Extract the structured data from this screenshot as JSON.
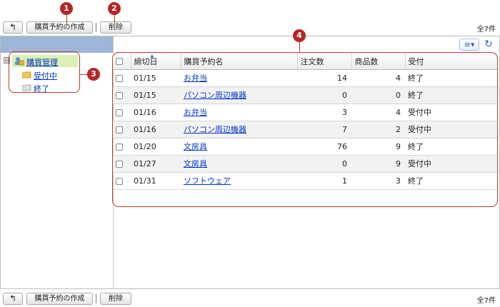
{
  "toolbar": {
    "back_icon": "undo-arrow-icon",
    "back_glyph": "↰",
    "create_label": "購買予約の作成",
    "delete_label": "削除",
    "count_label": "全7件"
  },
  "tree": {
    "root_label": "購買管理",
    "expander": "⊟",
    "items": [
      {
        "label": "受付中"
      },
      {
        "label": "終了"
      }
    ]
  },
  "view_toggle": "≡▾",
  "refresh_glyph": "↻",
  "table": {
    "headers": [
      "締切日",
      "購買予約名",
      "注文数",
      "商品数",
      "受付"
    ],
    "rows": [
      {
        "date": "01/15",
        "name": "お弁当",
        "orders": "14",
        "items": "4",
        "status": "終了"
      },
      {
        "date": "01/15",
        "name": "パソコン周辺機器",
        "orders": "0",
        "items": "0",
        "status": "終了"
      },
      {
        "date": "01/16",
        "name": "お弁当",
        "orders": "3",
        "items": "4",
        "status": "受付中"
      },
      {
        "date": "01/16",
        "name": "パソコン周辺機器",
        "orders": "7",
        "items": "2",
        "status": "受付中"
      },
      {
        "date": "01/20",
        "name": "文房具",
        "orders": "76",
        "items": "9",
        "status": "終了"
      },
      {
        "date": "01/27",
        "name": "文房具",
        "orders": "0",
        "items": "9",
        "status": "受付中"
      },
      {
        "date": "01/31",
        "name": "ソフトウェア",
        "orders": "1",
        "items": "3",
        "status": "終了"
      }
    ]
  },
  "badges": [
    "1",
    "2",
    "3",
    "4"
  ],
  "colors": {
    "accent": "#b52626",
    "link": "#0033cc",
    "tree_selected": "#dcf0b6",
    "left_header": "#9eb6d8"
  }
}
